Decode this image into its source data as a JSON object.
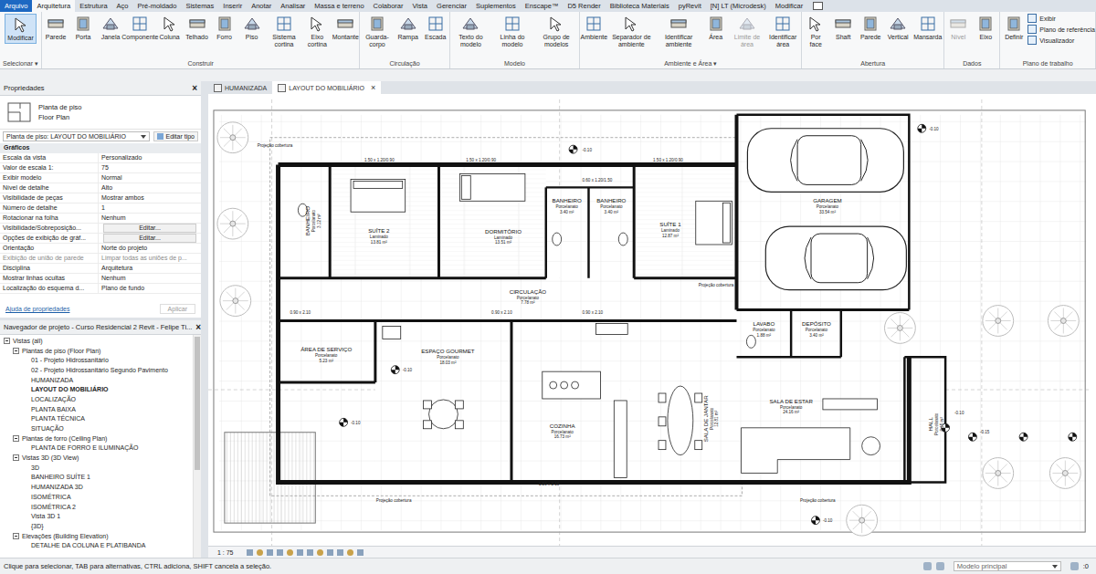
{
  "ribbon_tabs": [
    {
      "label": "Arquivo",
      "kind": "file",
      "selected": false
    },
    {
      "label": "Arquitetura",
      "kind": "tab",
      "selected": true
    },
    {
      "label": "Estrutura",
      "kind": "tab",
      "selected": false
    },
    {
      "label": "Aço",
      "kind": "tab",
      "selected": false
    },
    {
      "label": "Pré-moldado",
      "kind": "tab",
      "selected": false
    },
    {
      "label": "Sistemas",
      "kind": "tab",
      "selected": false
    },
    {
      "label": "Inserir",
      "kind": "tab",
      "selected": false
    },
    {
      "label": "Anotar",
      "kind": "tab",
      "selected": false
    },
    {
      "label": "Analisar",
      "kind": "tab",
      "selected": false
    },
    {
      "label": "Massa e terreno",
      "kind": "tab",
      "selected": false
    },
    {
      "label": "Colaborar",
      "kind": "tab",
      "selected": false
    },
    {
      "label": "Vista",
      "kind": "tab",
      "selected": false
    },
    {
      "label": "Gerenciar",
      "kind": "tab",
      "selected": false
    },
    {
      "label": "Suplementos",
      "kind": "tab",
      "selected": false
    },
    {
      "label": "Enscape™",
      "kind": "tab",
      "selected": false
    },
    {
      "label": "D5 Render",
      "kind": "tab",
      "selected": false
    },
    {
      "label": "Biblioteca Materiais",
      "kind": "tab",
      "selected": false
    },
    {
      "label": "pyRevit",
      "kind": "tab",
      "selected": false
    },
    {
      "label": "[N] LT (Microdesk)",
      "kind": "tab",
      "selected": false
    },
    {
      "label": "Modificar",
      "kind": "tab",
      "selected": false
    }
  ],
  "ribbon_groups": [
    {
      "label": "Selecionar ▾",
      "buttons": [
        {
          "label": "Modificar",
          "selected": true,
          "disabled": false
        }
      ],
      "small_buttons": []
    },
    {
      "label": "Construir",
      "buttons": [
        {
          "label": "Parede",
          "selected": false,
          "disabled": false
        },
        {
          "label": "Porta",
          "selected": false,
          "disabled": false
        },
        {
          "label": "Janela",
          "selected": false,
          "disabled": false
        },
        {
          "label": "Componente",
          "selected": false,
          "disabled": false
        },
        {
          "label": "Coluna",
          "selected": false,
          "disabled": false
        },
        {
          "label": "Telhado",
          "selected": false,
          "disabled": false
        },
        {
          "label": "Forro",
          "selected": false,
          "disabled": false
        },
        {
          "label": "Piso",
          "selected": false,
          "disabled": false
        },
        {
          "label": "Sistema cortina",
          "selected": false,
          "disabled": false
        },
        {
          "label": "Eixo cortina",
          "selected": false,
          "disabled": false
        },
        {
          "label": "Montante",
          "selected": false,
          "disabled": false
        }
      ],
      "small_buttons": []
    },
    {
      "label": "Circulação",
      "buttons": [
        {
          "label": "Guarda-corpo",
          "selected": false,
          "disabled": false
        },
        {
          "label": "Rampa",
          "selected": false,
          "disabled": false
        },
        {
          "label": "Escada",
          "selected": false,
          "disabled": false
        }
      ],
      "small_buttons": []
    },
    {
      "label": "Modelo",
      "buttons": [
        {
          "label": "Texto do modelo",
          "selected": false,
          "disabled": false
        },
        {
          "label": "Linha do modelo",
          "selected": false,
          "disabled": false
        },
        {
          "label": "Grupo de modelos",
          "selected": false,
          "disabled": false
        }
      ],
      "small_buttons": []
    },
    {
      "label": "Ambiente e Área ▾",
      "buttons": [
        {
          "label": "Ambiente",
          "selected": false,
          "disabled": false
        },
        {
          "label": "Separador de ambiente",
          "selected": false,
          "disabled": false
        },
        {
          "label": "Identificar ambiente",
          "selected": false,
          "disabled": false
        },
        {
          "label": "Área",
          "selected": false,
          "disabled": false
        },
        {
          "label": "Limite de área",
          "selected": false,
          "disabled": true
        },
        {
          "label": "Identificar área",
          "selected": false,
          "disabled": false
        }
      ],
      "small_buttons": []
    },
    {
      "label": "Abertura",
      "buttons": [
        {
          "label": "Por face",
          "selected": false,
          "disabled": false
        },
        {
          "label": "Shaft",
          "selected": false,
          "disabled": false
        },
        {
          "label": "Parede",
          "selected": false,
          "disabled": false
        },
        {
          "label": "Vertical",
          "selected": false,
          "disabled": false
        },
        {
          "label": "Mansarda",
          "selected": false,
          "disabled": false
        }
      ],
      "small_buttons": []
    },
    {
      "label": "Dados",
      "buttons": [
        {
          "label": "Nível",
          "selected": false,
          "disabled": true
        },
        {
          "label": "Eixo",
          "selected": false,
          "disabled": false
        }
      ],
      "small_buttons": []
    },
    {
      "label": "Plano de trabalho",
      "buttons": [
        {
          "label": "Definir",
          "selected": false,
          "disabled": false
        }
      ],
      "small_buttons": [
        "Exibir",
        "Plano de referência",
        "Visualizador"
      ]
    }
  ],
  "properties": {
    "title": "Propriedades",
    "close": "×",
    "type_name": "Planta de piso",
    "type_sub": "Floor Plan",
    "instance": "Planta de piso: LAYOUT DO MOBILIÁRIO",
    "edit_type": "Editar tipo",
    "section": "Gráficos",
    "rows": [
      {
        "label": "Escala da vista",
        "value": "Personalizado",
        "kind": "text",
        "disabled": false
      },
      {
        "label": "Valor de escala    1:",
        "value": "75",
        "kind": "text",
        "disabled": false
      },
      {
        "label": "Exibir modelo",
        "value": "Normal",
        "kind": "text",
        "disabled": false
      },
      {
        "label": "Nível de detalhe",
        "value": "Alto",
        "kind": "text",
        "disabled": false
      },
      {
        "label": "Visibilidade de peças",
        "value": "Mostrar ambos",
        "kind": "text",
        "disabled": false
      },
      {
        "label": "Número de detalhe",
        "value": "1",
        "kind": "text",
        "disabled": false
      },
      {
        "label": "Rotacionar na folha",
        "value": "Nenhum",
        "kind": "text",
        "disabled": false
      },
      {
        "label": "Visibilidade/Sobreposição...",
        "value": "Editar...",
        "kind": "button",
        "disabled": false
      },
      {
        "label": "Opções de exibição de gráf...",
        "value": "Editar...",
        "kind": "button",
        "disabled": false
      },
      {
        "label": "Orientação",
        "value": "Norte do projeto",
        "kind": "text",
        "disabled": false
      },
      {
        "label": "Exibição de união de parede",
        "value": "Limpar todas as uniões de p...",
        "kind": "text",
        "disabled": true
      },
      {
        "label": "Disciplina",
        "value": "Arquitetura",
        "kind": "text",
        "disabled": false
      },
      {
        "label": "Mostrar linhas ocultas",
        "value": "Nenhum",
        "kind": "text",
        "disabled": false
      },
      {
        "label": "Localização do esquema d...",
        "value": "Plano de fundo",
        "kind": "text",
        "disabled": false
      }
    ],
    "help": "Ajuda de propriedades",
    "apply": "Aplicar"
  },
  "browser": {
    "title": "Navegador de projeto - Curso Residencial 2 Revit - Felipe Ti...",
    "close": "×",
    "items": [
      {
        "label": "Vistas (all)",
        "level": 0,
        "kind": "folder",
        "expanded": true,
        "selected": false
      },
      {
        "label": "Plantas de piso (Floor Plan)",
        "level": 1,
        "kind": "folder",
        "expanded": true,
        "selected": false
      },
      {
        "label": "01 - Projeto Hidrossanitário",
        "level": 2,
        "kind": "view",
        "expanded": false,
        "selected": false
      },
      {
        "label": "02 - Projeto Hidrossanitário Segundo Pavimento",
        "level": 2,
        "kind": "view",
        "expanded": false,
        "selected": false
      },
      {
        "label": "HUMANIZADA",
        "level": 2,
        "kind": "view",
        "expanded": false,
        "selected": false
      },
      {
        "label": "LAYOUT DO MOBILIÁRIO",
        "level": 2,
        "kind": "view",
        "expanded": false,
        "selected": true
      },
      {
        "label": "LOCALIZAÇÃO",
        "level": 2,
        "kind": "view",
        "expanded": false,
        "selected": false
      },
      {
        "label": "PLANTA BAIXA",
        "level": 2,
        "kind": "view",
        "expanded": false,
        "selected": false
      },
      {
        "label": "PLANTA TÉCNICA",
        "level": 2,
        "kind": "view",
        "expanded": false,
        "selected": false
      },
      {
        "label": "SITUAÇÃO",
        "level": 2,
        "kind": "view",
        "expanded": false,
        "selected": false
      },
      {
        "label": "Plantas de forro (Ceiling Plan)",
        "level": 1,
        "kind": "folder",
        "expanded": true,
        "selected": false
      },
      {
        "label": "PLANTA DE FORRO E ILUMINAÇÃO",
        "level": 2,
        "kind": "view",
        "expanded": false,
        "selected": false
      },
      {
        "label": "Vistas 3D (3D View)",
        "level": 1,
        "kind": "folder",
        "expanded": true,
        "selected": false
      },
      {
        "label": "3D",
        "level": 2,
        "kind": "view",
        "expanded": false,
        "selected": false
      },
      {
        "label": "BANHEIRO SUÍTE 1",
        "level": 2,
        "kind": "view",
        "expanded": false,
        "selected": false
      },
      {
        "label": "HUMANIZADA 3D",
        "level": 2,
        "kind": "view",
        "expanded": false,
        "selected": false
      },
      {
        "label": "ISOMÉTRICA",
        "level": 2,
        "kind": "view",
        "expanded": false,
        "selected": false
      },
      {
        "label": "ISOMÉTRICA 2",
        "level": 2,
        "kind": "view",
        "expanded": false,
        "selected": false
      },
      {
        "label": "Vista 3D 1",
        "level": 2,
        "kind": "view",
        "expanded": false,
        "selected": false
      },
      {
        "label": "{3D}",
        "level": 2,
        "kind": "view",
        "expanded": false,
        "selected": false
      },
      {
        "label": "Elevações (Building Elevation)",
        "level": 1,
        "kind": "folder",
        "expanded": true,
        "selected": false
      },
      {
        "label": "DETALHE DA COLUNA E PLATIBANDA",
        "level": 2,
        "kind": "view",
        "expanded": false,
        "selected": false
      }
    ]
  },
  "view_tabs": [
    {
      "label": "HUMANIZADA",
      "selected": false,
      "close": ""
    },
    {
      "label": "LAYOUT DO MOBILIÁRIO",
      "selected": true,
      "close": "×"
    }
  ],
  "plan": {
    "rooms": [
      {
        "name": "BANHEIRO",
        "floor": "Porcelanato",
        "area": "3.12 m²"
      },
      {
        "name": "SUÍTE 2",
        "floor": "Laminado",
        "area": "13.81 m²"
      },
      {
        "name": "DORMITÓRIO",
        "floor": "Laminado",
        "area": "13.51 m²"
      },
      {
        "name": "BANHEIRO",
        "floor": "Porcelanato",
        "area": "3.40 m²"
      },
      {
        "name": "BANHEIRO",
        "floor": "Porcelanato",
        "area": "3.40 m²"
      },
      {
        "name": "SUÍTE 1",
        "floor": "Laminado",
        "area": "12.87 m²"
      },
      {
        "name": "GARAGEM",
        "floor": "Porcelanato",
        "area": "33.54 m²"
      },
      {
        "name": "CIRCULAÇÃO",
        "floor": "Porcelanato",
        "area": "7.78 m²"
      },
      {
        "name": "ÁREA DE SERVIÇO",
        "floor": "Porcelanato",
        "area": "5.23 m²"
      },
      {
        "name": "ESPAÇO GOURMET",
        "floor": "Porcelanato",
        "area": "18.03 m²"
      },
      {
        "name": "COZINHA",
        "floor": "Porcelanato",
        "area": "16.73 m²"
      },
      {
        "name": "SALA DE JANTAR",
        "floor": "Porcelanato",
        "area": "12.81 m²"
      },
      {
        "name": "SALA DE ESTAR",
        "floor": "Porcelanato",
        "area": "24.16 m²"
      },
      {
        "name": "LAVABO",
        "floor": "Porcelanato",
        "area": "1.88 m²"
      },
      {
        "name": "DEPÓSITO",
        "floor": "Porcelanato",
        "area": "3.40 m²"
      },
      {
        "name": "HALL",
        "floor": "Porcelanato",
        "area": "6.15 m²"
      }
    ],
    "annotations": [
      "Projeção cobertura",
      "Projeção cobertura",
      "Projeção cobertura",
      "Projeção cobertura",
      "-0.10",
      "-0.10",
      "-0.10",
      "-0.10",
      "-0.10",
      "-0.10",
      "-0.15",
      "1.50 x 1.20/0.90",
      "1.50 x 1.20/0.90",
      "1.50 x 1.20/0.90",
      "0.60 x 1.20/1.50",
      "0.90 x 2.10",
      "0.90 x 2.10",
      "0.90 x 2.10",
      "1.50 x 2.10"
    ]
  },
  "view_bar": {
    "scale": "1 : 75"
  },
  "status_bar": {
    "hint": "Clique para selecionar, TAB para alternativas, CTRL adiciona, SHIFT cancela a seleção.",
    "model": "Modelo principal",
    "count": ":0"
  }
}
